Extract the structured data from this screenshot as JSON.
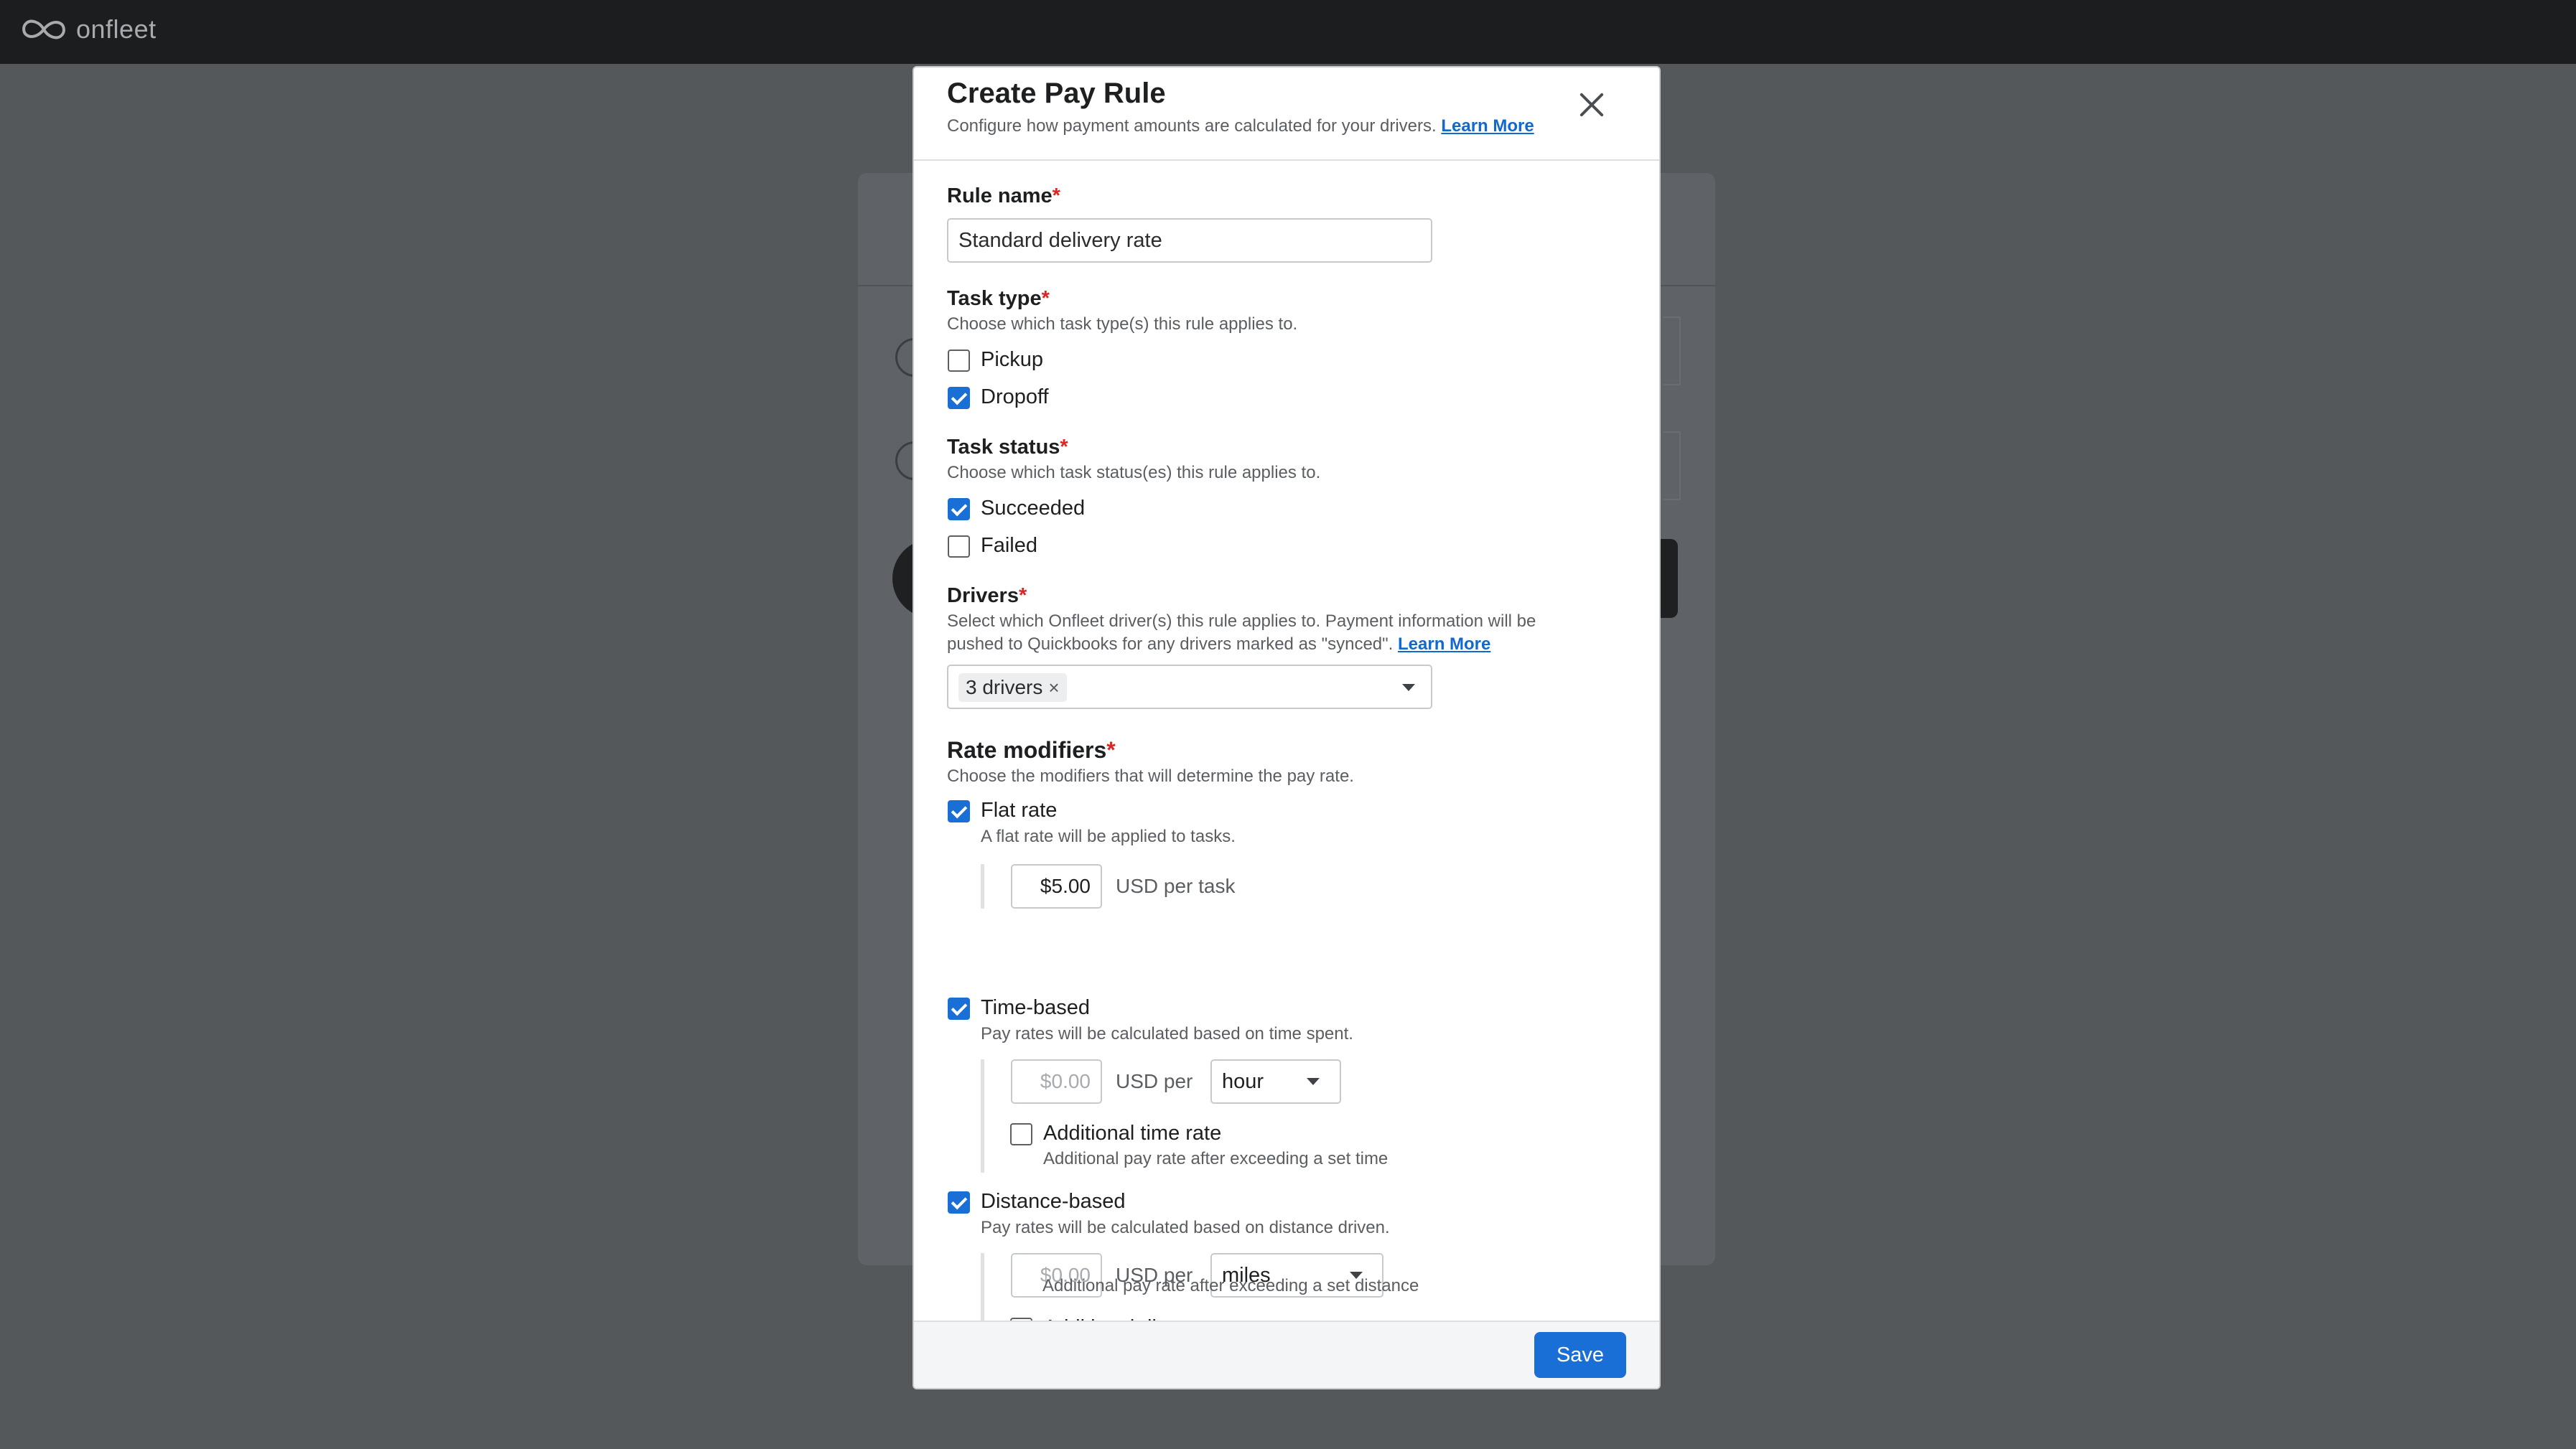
{
  "app": {
    "logo_text": "onfleet"
  },
  "modal": {
    "title": "Create Pay Rule",
    "subtitle": "Configure how payment amounts are calculated for your drivers.",
    "subtitle_link": "Learn More"
  },
  "rule_name": {
    "label": "Rule name",
    "required_mark": "*",
    "value": "Standard delivery rate"
  },
  "task_type": {
    "label": "Task type",
    "required_mark": "*",
    "help": "Choose which task type(s) this rule applies to.",
    "options": [
      {
        "label": "Pickup",
        "checked": false
      },
      {
        "label": "Dropoff",
        "checked": true
      }
    ]
  },
  "task_status": {
    "label": "Task status",
    "required_mark": "*",
    "help": "Choose which task status(es) this rule applies to.",
    "options": [
      {
        "label": "Succeeded",
        "checked": true
      },
      {
        "label": "Failed",
        "checked": false
      }
    ]
  },
  "drivers": {
    "label": "Drivers",
    "required_mark": "*",
    "help_line1": "Select which Onfleet driver(s) this rule applies to. Payment information will be",
    "help_line2": "pushed to Quickbooks for any drivers marked as \"synced\".",
    "help_link": "Learn More",
    "chip_label": "3 drivers",
    "chip_remove": "×"
  },
  "rate_modifiers": {
    "title": "Rate modifiers",
    "required_mark": "*",
    "help": "Choose the modifiers that will determine the pay rate.",
    "flat_rate": {
      "label": "Flat rate",
      "checked": true,
      "help": "A flat rate will be applied to tasks.",
      "amount": "$5.00",
      "unit": "USD per task"
    },
    "time_based": {
      "label": "Time-based",
      "checked": true,
      "help": "Pay rates will be calculated based on time spent.",
      "amount_placeholder": "$0.00",
      "unit": "USD per",
      "period": "hour",
      "additional_label": "Additional time rate",
      "additional_checked": false,
      "additional_help": "Additional pay rate after exceeding a set time"
    },
    "distance_based": {
      "label": "Distance-based",
      "checked": true,
      "help": "Pay rates will be calculated based on distance driven.",
      "amount_placeholder": "$0.00",
      "unit": "USD per",
      "distance_unit": "miles",
      "additional_label": "Additional distance rate",
      "additional_checked": false,
      "additional_help": "Additional pay rate after exceeding a set distance"
    }
  },
  "footer": {
    "save_label": "Save"
  },
  "colors": {
    "accent": "#1a6fd6",
    "required": "#e02424",
    "overlay": "#55585b",
    "topbar": "#1c1d1f"
  }
}
